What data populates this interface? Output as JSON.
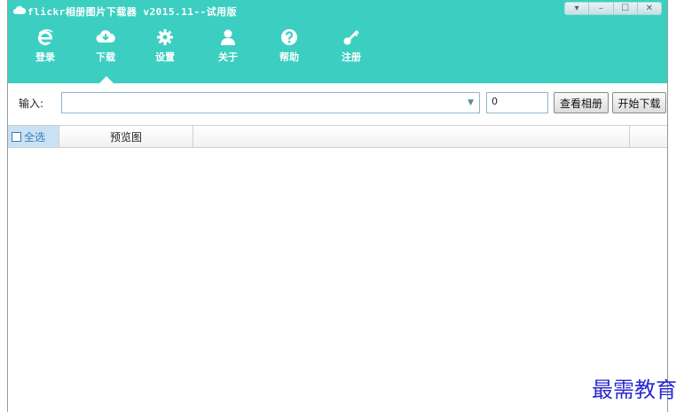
{
  "window": {
    "title": "flickr相册图片下载器 v2015.11--试用版",
    "controls": {
      "menu": "▾",
      "minimize": "–",
      "maximize": "☐",
      "close": "✕"
    }
  },
  "toolbar": {
    "items": [
      {
        "label": "登录",
        "icon": "ie-icon"
      },
      {
        "label": "下载",
        "icon": "cloud-download-icon"
      },
      {
        "label": "设置",
        "icon": "gear-icon"
      },
      {
        "label": "关于",
        "icon": "user-icon"
      },
      {
        "label": "帮助",
        "icon": "help-icon"
      },
      {
        "label": "注册",
        "icon": "key-icon"
      }
    ],
    "active": "下载"
  },
  "input_row": {
    "label": "输入:",
    "url_value": "",
    "count_value": "0",
    "view_album_button": "查看相册",
    "start_download_button": "开始下载"
  },
  "table": {
    "select_all": "全选",
    "preview_column": "预览图",
    "rows": []
  },
  "watermark": "最需教育",
  "colors": {
    "accent": "#3ccfc1",
    "selected_header": "#c8e2f3"
  }
}
